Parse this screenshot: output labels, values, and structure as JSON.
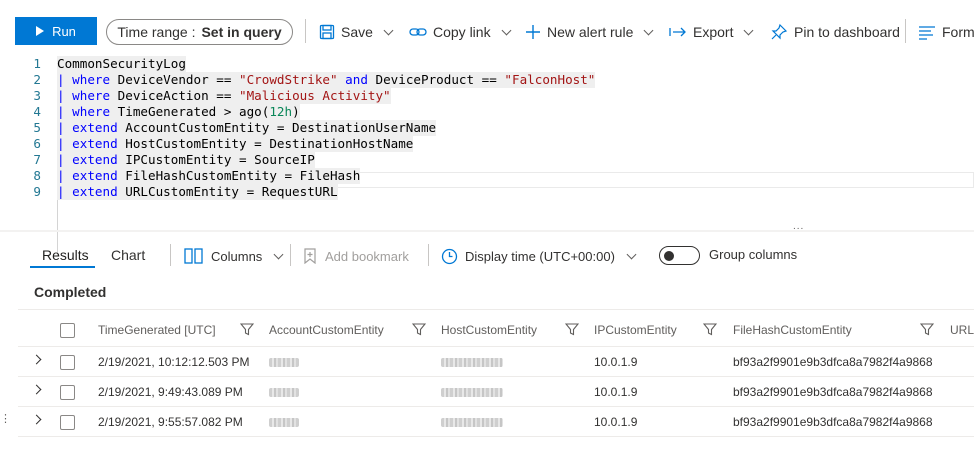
{
  "toolbar": {
    "run_label": "Run",
    "time_range_label": "Time range :",
    "time_range_value": "Set in query",
    "save_label": "Save",
    "copy_link_label": "Copy link",
    "new_alert_label": "New alert rule",
    "export_label": "Export",
    "pin_label": "Pin to dashboard",
    "format_label": "Form"
  },
  "editor": {
    "lines": [
      {
        "num": "1",
        "tokens": [
          {
            "t": "CommonSecurityLog",
            "c": "plain"
          }
        ]
      },
      {
        "num": "2",
        "tokens": [
          {
            "t": "| ",
            "c": "pipe"
          },
          {
            "t": "where",
            "c": "kw"
          },
          {
            "t": " DeviceVendor == ",
            "c": "plain"
          },
          {
            "t": "\"CrowdStrike\"",
            "c": "str"
          },
          {
            "t": " ",
            "c": "plain"
          },
          {
            "t": "and",
            "c": "kw"
          },
          {
            "t": " DeviceProduct == ",
            "c": "plain"
          },
          {
            "t": "\"FalconHost\"",
            "c": "str"
          }
        ]
      },
      {
        "num": "3",
        "tokens": [
          {
            "t": "| ",
            "c": "pipe"
          },
          {
            "t": "where",
            "c": "kw"
          },
          {
            "t": " DeviceAction == ",
            "c": "plain"
          },
          {
            "t": "\"Malicious Activity\"",
            "c": "str"
          }
        ]
      },
      {
        "num": "4",
        "tokens": [
          {
            "t": "| ",
            "c": "pipe"
          },
          {
            "t": "where",
            "c": "kw"
          },
          {
            "t": " TimeGenerated > ago(",
            "c": "plain"
          },
          {
            "t": "12h",
            "c": "num"
          },
          {
            "t": ")",
            "c": "plain"
          }
        ]
      },
      {
        "num": "5",
        "tokens": [
          {
            "t": "| ",
            "c": "pipe"
          },
          {
            "t": "extend",
            "c": "kw"
          },
          {
            "t": " AccountCustomEntity = DestinationUserName",
            "c": "plain"
          }
        ]
      },
      {
        "num": "6",
        "tokens": [
          {
            "t": "| ",
            "c": "pipe"
          },
          {
            "t": "extend",
            "c": "kw"
          },
          {
            "t": " HostCustomEntity = DestinationHostName",
            "c": "plain"
          }
        ]
      },
      {
        "num": "7",
        "tokens": [
          {
            "t": "| ",
            "c": "pipe"
          },
          {
            "t": "extend",
            "c": "kw"
          },
          {
            "t": " IPCustomEntity = SourceIP",
            "c": "plain"
          }
        ]
      },
      {
        "num": "8",
        "tokens": [
          {
            "t": "| ",
            "c": "pipe"
          },
          {
            "t": "extend",
            "c": "kw"
          },
          {
            "t": " FileHashCustomEntity = FileHash",
            "c": "plain"
          }
        ]
      },
      {
        "num": "9",
        "tokens": [
          {
            "t": "| ",
            "c": "pipe"
          },
          {
            "t": "extend",
            "c": "kw"
          },
          {
            "t": " URLCustomEntity = RequestURL",
            "c": "plain"
          }
        ]
      }
    ],
    "splitter_dots": "..."
  },
  "results_bar": {
    "tab_results": "Results",
    "tab_chart": "Chart",
    "columns_label": "Columns",
    "add_bookmark_label": "Add bookmark",
    "display_time_label": "Display time (UTC+00:00)",
    "group_columns_label": "Group columns",
    "status": "Completed"
  },
  "grid": {
    "columns": [
      "TimeGenerated [UTC]",
      "AccountCustomEntity",
      "HostCustomEntity",
      "IPCustomEntity",
      "FileHashCustomEntity",
      "URLC"
    ],
    "rows": [
      {
        "time": "2/19/2021, 10:12:12.503 PM",
        "ip": "10.0.1.9",
        "filehash": "bf93a2f9901e9b3dfca8a7982f4a9868"
      },
      {
        "time": "2/19/2021, 9:49:43.089 PM",
        "ip": "10.0.1.9",
        "filehash": "bf93a2f9901e9b3dfca8a7982f4a9868"
      },
      {
        "time": "2/19/2021, 9:55:57.082 PM",
        "ip": "10.0.1.9",
        "filehash": "bf93a2f9901e9b3dfca8a7982f4a9868"
      }
    ]
  },
  "colors": {
    "accent": "#0078d4",
    "keyword": "#0000ff",
    "string": "#a31515",
    "number": "#098658",
    "line_number": "#237893"
  },
  "icons": {
    "run": "play-icon",
    "save": "save-icon",
    "copy_link": "link-icon",
    "new_alert": "plus-icon",
    "export": "export-arrow-icon",
    "pin": "pin-icon",
    "format": "format-lines-icon",
    "columns": "columns-icon",
    "bookmark": "bookmark-icon",
    "clock": "clock-icon",
    "toggle": "toggle-icon",
    "filter": "filter-icon",
    "expand": "chevron-right-icon"
  }
}
